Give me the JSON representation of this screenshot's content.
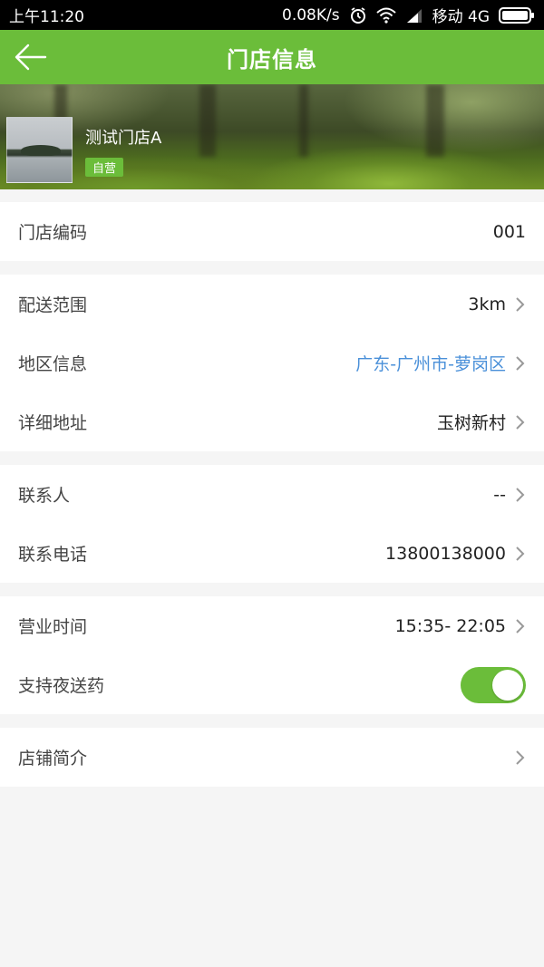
{
  "status_bar": {
    "time": "上午11:20",
    "speed": "0.08K/s",
    "carrier": "移动 4G"
  },
  "nav": {
    "title": "门店信息",
    "back_icon": "arrow-left-icon"
  },
  "store": {
    "name": "测试门店A",
    "badge": "自营"
  },
  "groups": [
    [
      {
        "label": "门店编码",
        "value": "001",
        "arrow": false
      }
    ],
    [
      {
        "label": "配送范围",
        "value": "3km",
        "arrow": true
      },
      {
        "label": "地区信息",
        "value": "广东-广州市-萝岗区",
        "arrow": true,
        "link": true
      },
      {
        "label": "详细地址",
        "value": "玉树新村",
        "arrow": true
      }
    ],
    [
      {
        "label": "联系人",
        "value": "--",
        "arrow": true
      },
      {
        "label": "联系电话",
        "value": "13800138000",
        "arrow": true
      }
    ],
    [
      {
        "label": "营业时间",
        "value": "15:35- 22:05",
        "arrow": true
      },
      {
        "label": "支持夜送药",
        "toggle_on": true
      }
    ],
    [
      {
        "label": "店铺简介",
        "value": "",
        "arrow": true
      }
    ]
  ],
  "colors": {
    "accent": "#6bbd3a",
    "link": "#4a90d9",
    "background": "#f5f5f5"
  }
}
